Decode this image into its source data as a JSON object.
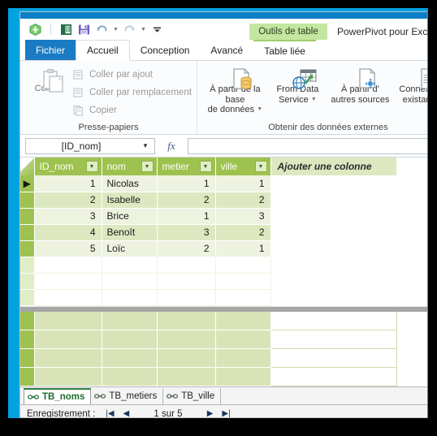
{
  "window": {
    "app_title": "PowerPivot pour Excel -",
    "contextual_tab_group": "Outils de table"
  },
  "quick_access": {
    "icons": [
      {
        "name": "powerpivot-icon",
        "label": "PowerPivot"
      },
      {
        "name": "excel-icon",
        "label": "Excel"
      },
      {
        "name": "save-icon",
        "label": "Enregistrer"
      },
      {
        "name": "undo-icon",
        "label": "Annuler"
      },
      {
        "name": "redo-icon",
        "label": "Rétablir"
      },
      {
        "name": "customize-qat-icon",
        "label": "Personnaliser"
      }
    ]
  },
  "ribbon": {
    "tabs": [
      {
        "label": "Fichier",
        "state": "file"
      },
      {
        "label": "Accueil",
        "state": "selected"
      },
      {
        "label": "Conception",
        "state": "normal"
      },
      {
        "label": "Avancé",
        "state": "normal"
      },
      {
        "label": "Table liée",
        "state": "contextual"
      }
    ],
    "groups": [
      {
        "title": "Presse-papiers",
        "big_button": "Coller",
        "items": [
          "Coller par ajout",
          "Coller par remplacement",
          "Copier"
        ]
      },
      {
        "title": "Obtenir des données externes",
        "buttons": [
          {
            "line1": "À partir de la base",
            "line2": "de données",
            "has_caret": true
          },
          {
            "line1": "From Data",
            "line2": "Service",
            "has_caret": true
          },
          {
            "line1": "À partir d'",
            "line2": "autres sources",
            "has_caret": false
          },
          {
            "line1": "Connexions",
            "line2": "existantes",
            "has_caret": false
          }
        ]
      }
    ]
  },
  "formula_bar": {
    "name_box_value": "[ID_nom]",
    "fx_label": "fx",
    "input_value": ""
  },
  "table": {
    "columns": [
      "ID_nom",
      "nom",
      "metier",
      "ville"
    ],
    "add_column_label": "Ajouter une colonne",
    "rows": [
      {
        "ID_nom": "1",
        "nom": "Nicolas",
        "metier": "1",
        "ville": "1"
      },
      {
        "ID_nom": "2",
        "nom": "Isabelle",
        "metier": "2",
        "ville": "2"
      },
      {
        "ID_nom": "3",
        "nom": "Brice",
        "metier": "1",
        "ville": "3"
      },
      {
        "ID_nom": "4",
        "nom": "Benoît",
        "metier": "3",
        "ville": "2"
      },
      {
        "ID_nom": "5",
        "nom": "Loïc",
        "metier": "2",
        "ville": "1"
      }
    ],
    "active_row_index": 0,
    "row_marker": "▶"
  },
  "sheet_tabs": [
    {
      "label": "TB_noms",
      "active": true
    },
    {
      "label": "TB_metiers",
      "active": false
    },
    {
      "label": "TB_ville",
      "active": false
    }
  ],
  "status_bar": {
    "label": "Enregistrement :",
    "first_glyph": "|◀",
    "prev_glyph": "◀",
    "record_text": "1 sur 5",
    "next_glyph": "▶",
    "last_glyph": "▶|"
  },
  "colors": {
    "title_blue": "#0b7fc7",
    "frame_cyan": "#00a2e0",
    "file_tab_blue": "#1a7bc4",
    "contextual_green": "#c3e6a0",
    "header_green": "#9ec24f",
    "row_light": "#eef3e0",
    "row_dark": "#dde8c1",
    "nav_navy": "#17355e"
  }
}
